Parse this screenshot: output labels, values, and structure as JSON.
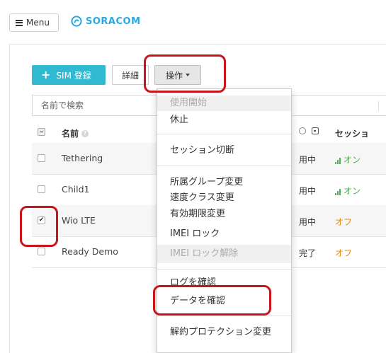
{
  "header": {
    "menu_label": "Menu",
    "logo_text": "SORACOM",
    "brand_color": "#27a9e1"
  },
  "toolbar": {
    "register_label": "SIM 登録",
    "detail_label": "詳細",
    "ops_label": "操作"
  },
  "search": {
    "placeholder": "名前で検索"
  },
  "table": {
    "columns": {
      "name": "名前",
      "session": "セッショ"
    },
    "rows": [
      {
        "name": "Tethering",
        "checked": false,
        "status": "用中",
        "session": "オン",
        "session_state": "online"
      },
      {
        "name": "Child1",
        "checked": false,
        "status": "用中",
        "session": "オン",
        "session_state": "online"
      },
      {
        "name": "Wio LTE",
        "checked": true,
        "status": "用中",
        "session": "オフ",
        "session_state": "offline"
      },
      {
        "name": "Ready Demo",
        "checked": false,
        "status": "完了",
        "session": "オフ",
        "session_state": "offline"
      }
    ]
  },
  "dropdown": {
    "items": [
      {
        "label": "使用開始",
        "disabled": true
      },
      {
        "label": "休止",
        "disabled": false
      },
      {
        "label": "セッション切断",
        "disabled": false
      },
      {
        "label": "所属グループ変更",
        "disabled": false
      },
      {
        "label": "速度クラス変更",
        "disabled": false
      },
      {
        "label": "有効期限変更",
        "disabled": false
      },
      {
        "label": "IMEI ロック",
        "disabled": false
      },
      {
        "label": "IMEI ロック解除",
        "disabled": true
      },
      {
        "label": "ログを確認",
        "disabled": false
      },
      {
        "label": "データを確認",
        "disabled": false
      },
      {
        "label": "解約プロテクション変更",
        "disabled": false
      }
    ]
  },
  "colors": {
    "accent": "#30b9d1",
    "online": "#4caf50",
    "offline": "#e68a00",
    "highlight": "#c8151b"
  }
}
